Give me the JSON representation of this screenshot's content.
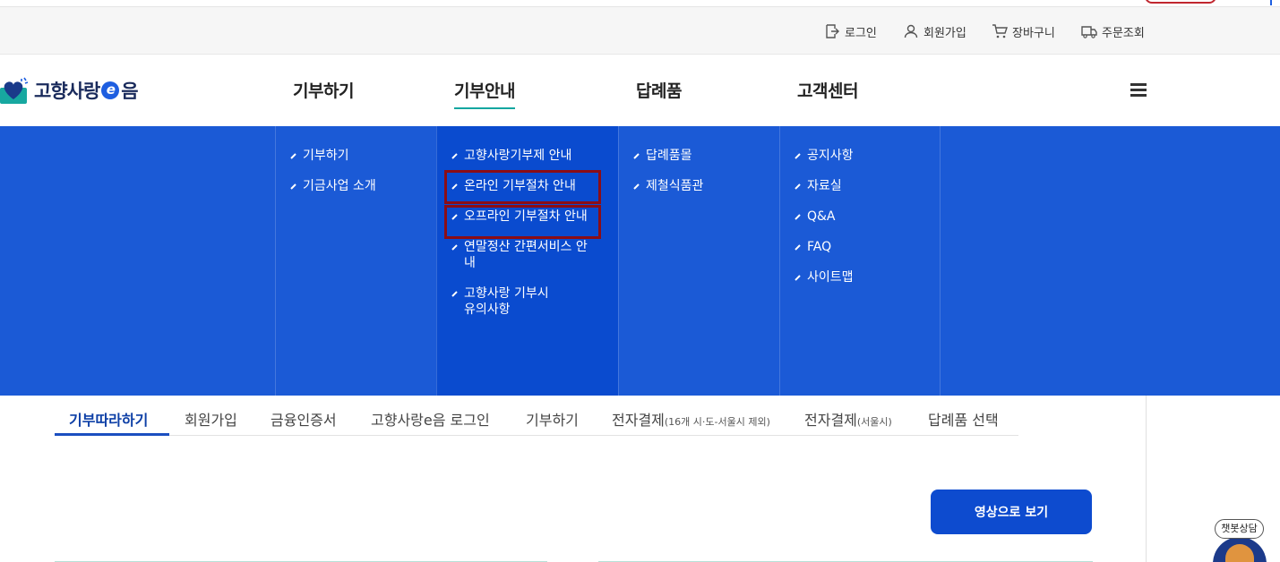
{
  "util": {
    "login": "로그인",
    "signup": "회원가입",
    "cart": "장바구니",
    "orders": "주문조회"
  },
  "logo": {
    "pre": "고향사랑",
    "e": "e",
    "post": "음"
  },
  "gnb": [
    "기부하기",
    "기부안내",
    "답례품",
    "고객센터"
  ],
  "mega": {
    "col1": [
      "기부하기",
      "기금사업 소개"
    ],
    "col2": [
      "고향사랑기부제 안내",
      "온라인 기부절차 안내",
      "오프라인 기부절차 안내",
      "연말정산 간편서비스 안내",
      "고향사랑 기부시 유의사항"
    ],
    "col3": [
      "답례품몰",
      "제철식품관"
    ],
    "col4": [
      "공지사항",
      "자료실",
      "Q&A",
      "FAQ",
      "사이트맵"
    ]
  },
  "tabs": {
    "t1": "기부따라하기",
    "t2": "회원가입",
    "t3": "금융인증서",
    "t4": "고향사랑e음 로그인",
    "t5": "기부하기",
    "t6": "전자결제",
    "t6_note": "(16개 시·도-서울시 제외)",
    "t7": "전자결제",
    "t7_note": "(서울시)",
    "t8": "답례품 선택"
  },
  "video_button": "영상으로 보기",
  "chatbot": "챗봇상담",
  "colors": {
    "menu_bg": "#1b5ad6",
    "menu_active": "#0a4bcf",
    "highlight": "#8b0d16",
    "accent": "#12a6a0"
  }
}
